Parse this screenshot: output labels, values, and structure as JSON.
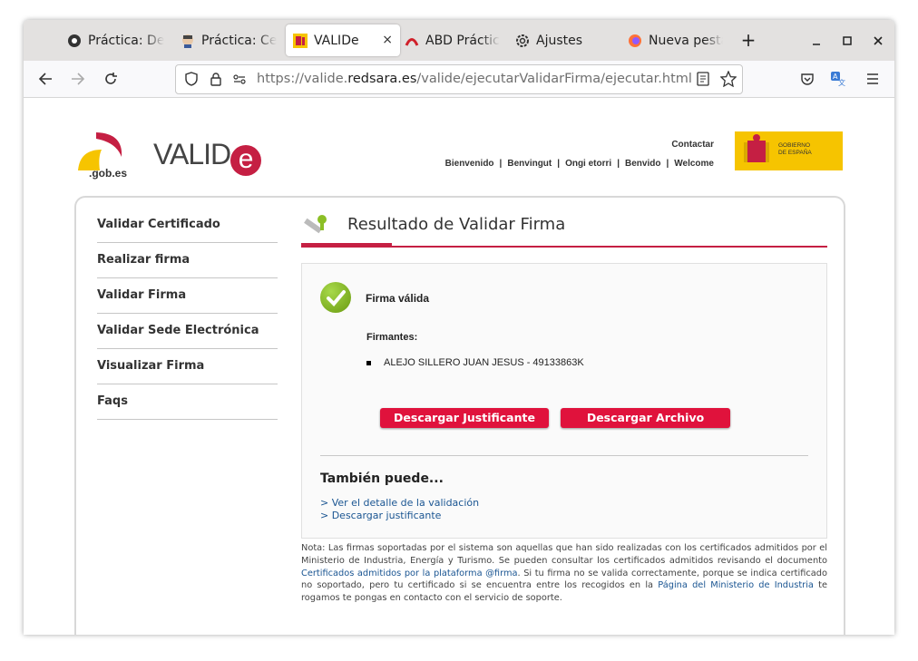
{
  "browser": {
    "tabs": [
      {
        "label": "Práctica: De",
        "icon": "moodle-icon"
      },
      {
        "label": "Práctica: Ce",
        "icon": "avatar-icon"
      },
      {
        "label": "VALIDe",
        "icon": "spain-shield-icon",
        "close": "×"
      },
      {
        "label": "ABD Práctic",
        "icon": "arc-logo-icon"
      },
      {
        "label": "Ajustes",
        "icon": "gear-icon"
      },
      {
        "label": "Nueva pesta",
        "icon": "firefox-icon"
      }
    ],
    "new_tab": "+",
    "url_prefix": "https://valide.",
    "url_domain": "redsara.es",
    "url_path": "/valide/ejecutarValidarFirma/ejecutar.html"
  },
  "header": {
    "gob_text": ".gob.es",
    "valide_text": "VALID",
    "valide_e": "e",
    "contact": "Contactar",
    "lang_links": [
      "Bienvenido",
      "Benvingut",
      "Ongi etorri",
      "Benvido",
      "Welcome"
    ],
    "gov_line1": "GOBIERNO",
    "gov_line2": "DE ESPAÑA"
  },
  "sidebar": {
    "items": [
      "Validar Certificado",
      "Realizar firma",
      "Validar Firma",
      "Validar Sede Electrónica",
      "Visualizar Firma",
      "Faqs"
    ]
  },
  "main": {
    "title": "Resultado de Validar Firma",
    "status": "Firma válida",
    "firmantes_label": "Firmantes:",
    "firmante": "ALEJO SILLERO JUAN JESUS - 49133863K",
    "btn_justificante": "Descargar Justificante",
    "btn_archivo": "Descargar Archivo",
    "also_title": "También puede...",
    "link_detalle": "> Ver el detalle de la validación",
    "link_justificante": "> Descargar justificante",
    "note_1": "Nota: Las firmas soportadas por el sistema son aquellas que han sido realizadas con los certificados admitidos por el Ministerio de Industria, Energía y Turismo. Se pueden consultar los certificados admitidos revisando el documento ",
    "note_link1": "Certificados admitidos por la plataforma @firma",
    "note_2": ". Si tu firma no se valida correctamente, porque se indica certificado no soportado, pero tu certificado si se encuentra entre los recogidos en la ",
    "note_link2": "Página del Ministerio de Industria",
    "note_3": " te rogamos te pongas en contacto con el servicio de soporte."
  }
}
